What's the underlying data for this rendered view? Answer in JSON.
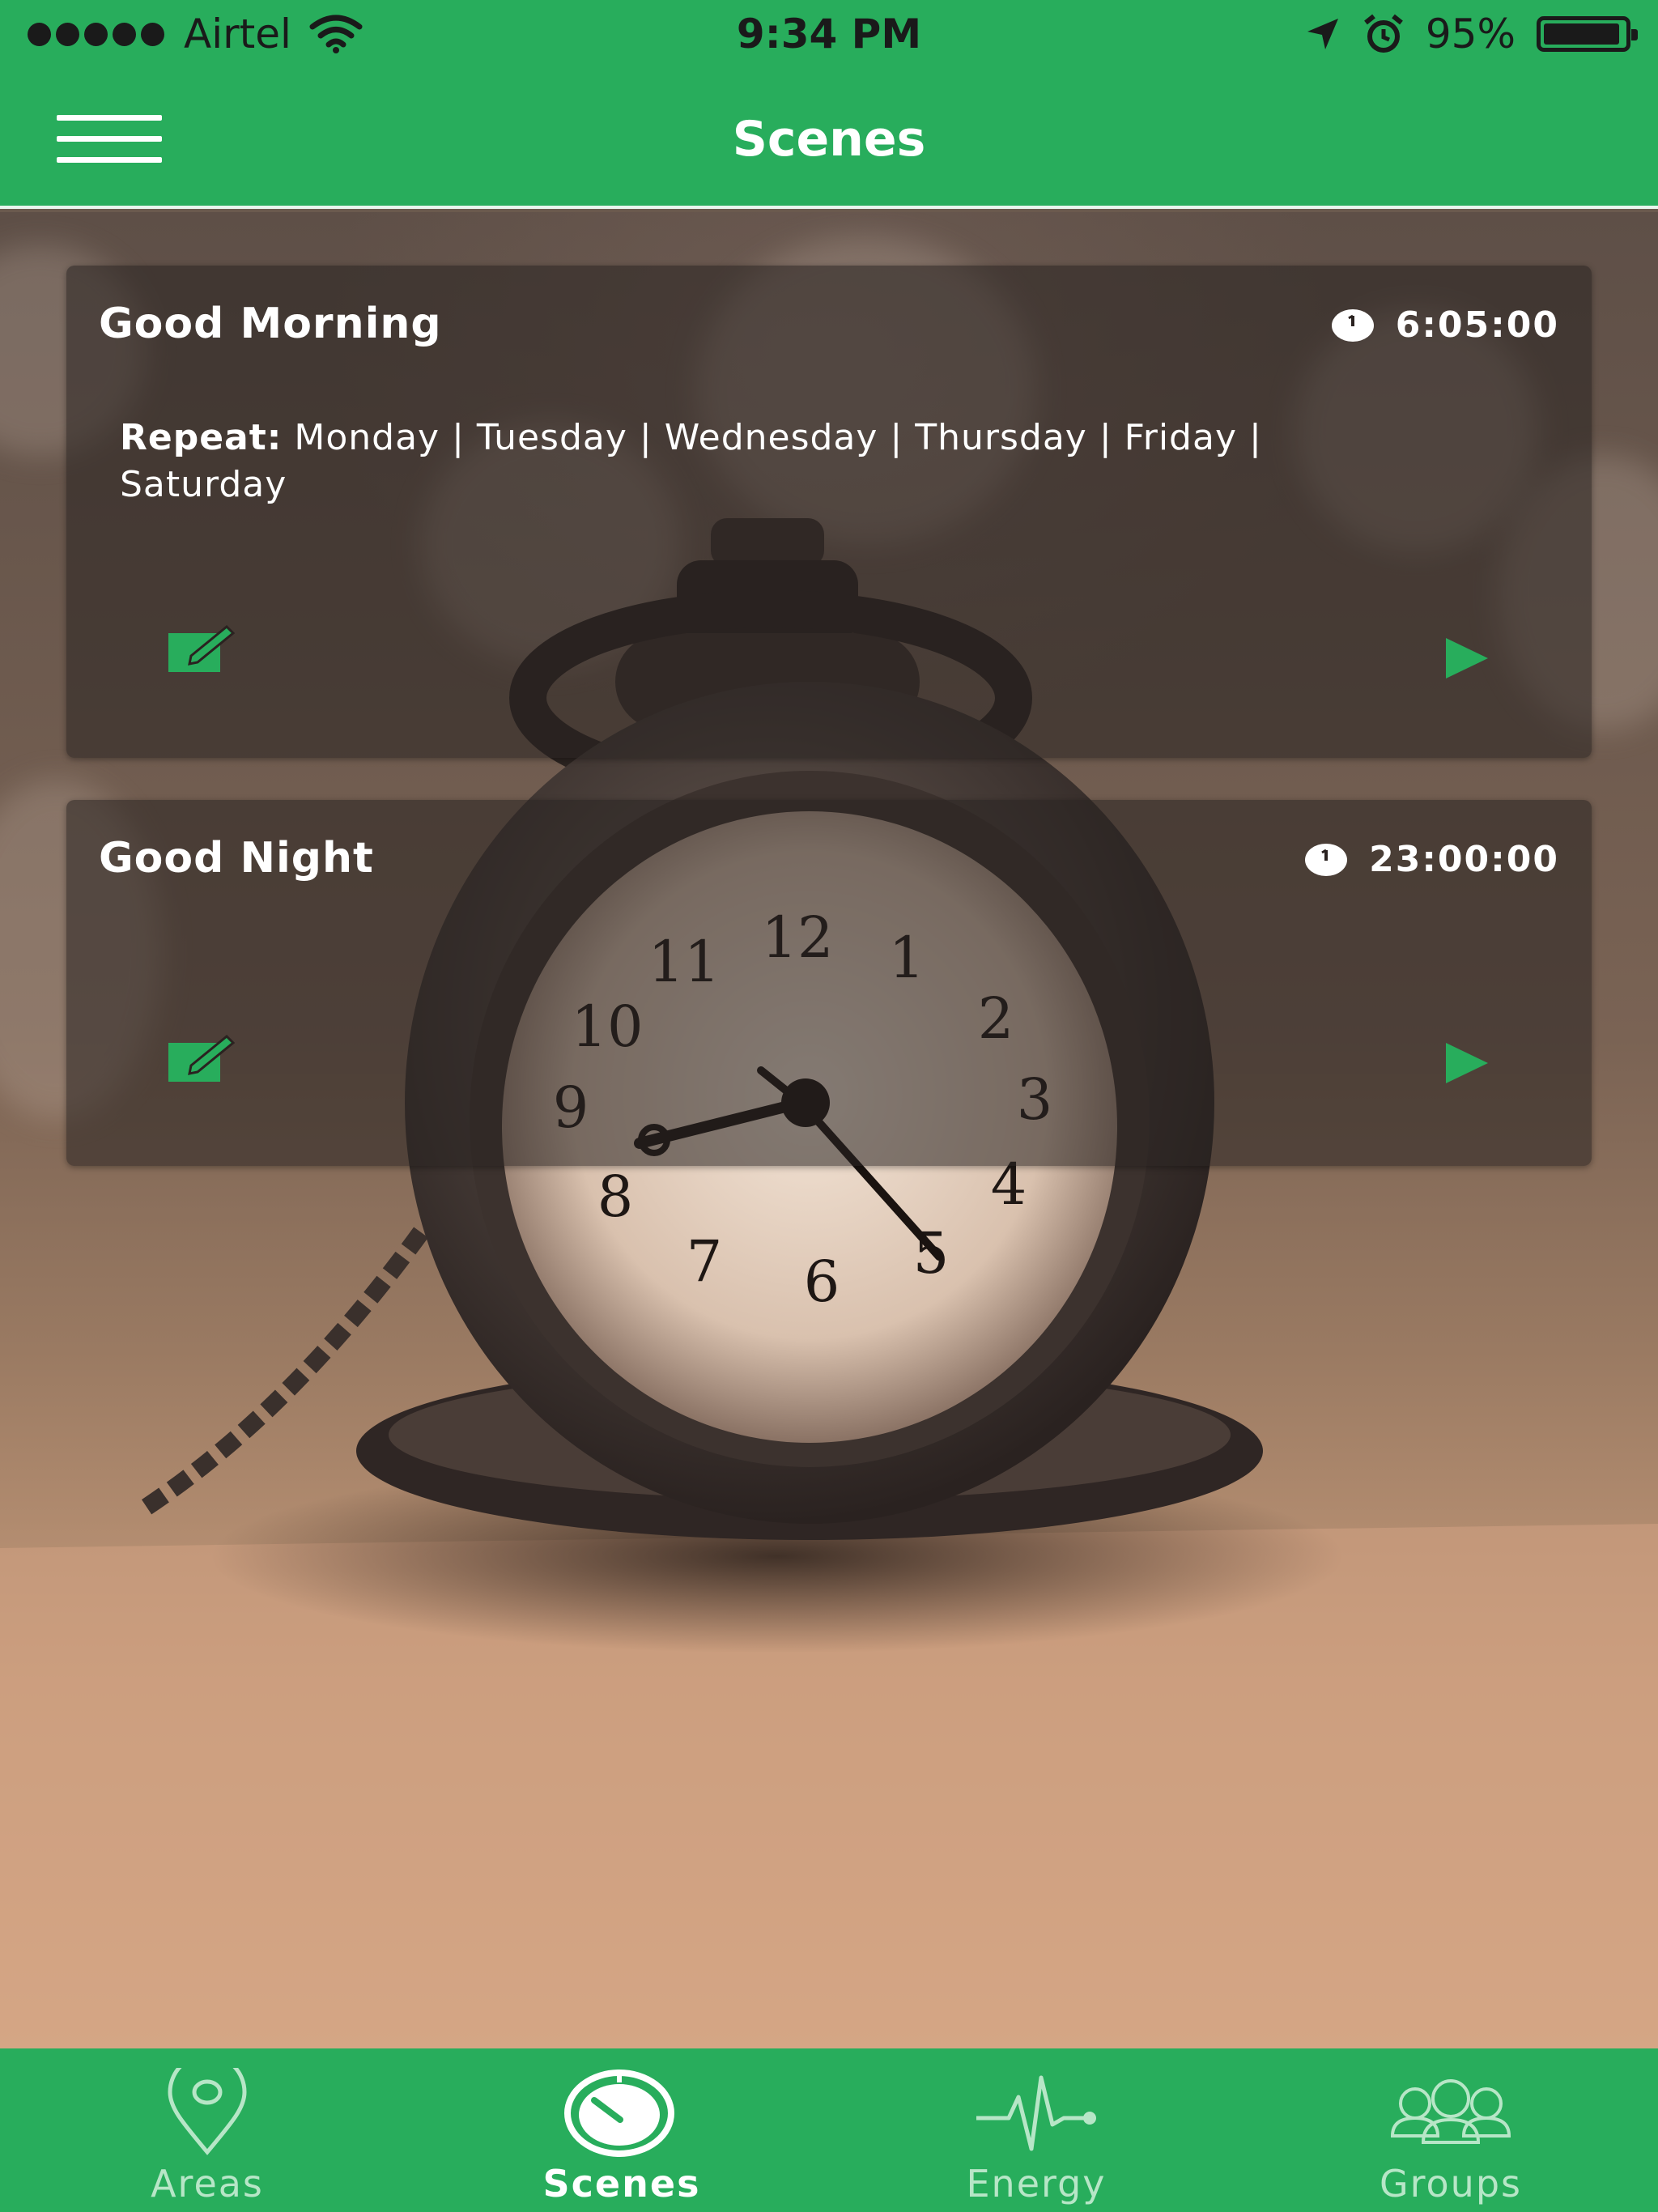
{
  "status_bar": {
    "carrier": "Airtel",
    "time": "9:34 PM",
    "battery_percent": "95%",
    "battery_level": 0.95,
    "signal_bars": 5
  },
  "header": {
    "title": "Scenes",
    "menu_icon": "hamburger-icon"
  },
  "scenes": [
    {
      "name": "Good Morning",
      "time": "6:05:00",
      "repeat_label": "Repeat:",
      "repeat_days_line1": "Monday | Tuesday | Wednesday | Thursday | Friday |",
      "repeat_days_line2": "Saturday",
      "edit_icon": "edit-icon",
      "play_icon": "play-icon"
    },
    {
      "name": "Good Night",
      "time": "23:00:00",
      "edit_icon": "edit-icon",
      "play_icon": "play-icon"
    }
  ],
  "tabs": [
    {
      "label": "Areas",
      "icon": "location-pin-icon",
      "active": false
    },
    {
      "label": "Scenes",
      "icon": "timer-icon",
      "active": true
    },
    {
      "label": "Energy",
      "icon": "pulse-icon",
      "active": false
    },
    {
      "label": "Groups",
      "icon": "group-icon",
      "active": false
    }
  ],
  "colors": {
    "brand_green": "#28ad5c",
    "inactive_tab": "#b7e6c7"
  }
}
